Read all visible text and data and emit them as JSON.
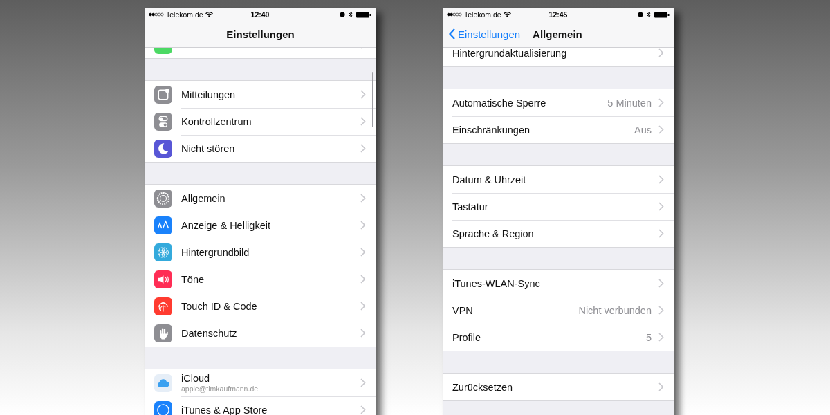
{
  "phones": [
    {
      "status": {
        "carrier": "Telekom.de",
        "time": "12:40"
      },
      "nav": {
        "title": "Einstellungen"
      },
      "groups": [
        {
          "rows": [
            {
              "kind": "green"
            }
          ]
        },
        {
          "rows": [
            {
              "kind": "notifications",
              "label": "Mitteilungen"
            },
            {
              "kind": "switches",
              "label": "Kontrollzentrum"
            },
            {
              "kind": "moon",
              "label": "Nicht stören"
            }
          ]
        },
        {
          "rows": [
            {
              "kind": "gear",
              "label": "Allgemein"
            },
            {
              "kind": "letters",
              "label": "Anzeige & Helligkeit"
            },
            {
              "kind": "flower",
              "label": "Hintergrundbild"
            },
            {
              "kind": "speaker",
              "label": "Töne"
            },
            {
              "kind": "fingerprint",
              "label": "Touch ID & Code"
            },
            {
              "kind": "hand",
              "label": "Datenschutz"
            }
          ]
        },
        {
          "rows": [
            {
              "kind": "cloud",
              "label": "iCloud",
              "subtitle": "apple@timkaufmann.de"
            },
            {
              "kind": "blue-circle",
              "label": "iTunes & App Store"
            }
          ]
        }
      ]
    },
    {
      "status": {
        "carrier": "Telekom.de",
        "time": "12:45"
      },
      "nav": {
        "title": "Allgemein",
        "back": "Einstellungen"
      },
      "groups": [
        {
          "rows": [
            {
              "label": "Hintergrundaktualisierung"
            }
          ]
        },
        {
          "rows": [
            {
              "label": "Automatische Sperre",
              "value": "5 Minuten"
            },
            {
              "label": "Einschränkungen",
              "value": "Aus"
            }
          ]
        },
        {
          "rows": [
            {
              "label": "Datum & Uhrzeit"
            },
            {
              "label": "Tastatur"
            },
            {
              "label": "Sprache & Region"
            }
          ]
        },
        {
          "rows": [
            {
              "label": "iTunes-WLAN-Sync"
            },
            {
              "label": "VPN",
              "value": "Nicht verbunden"
            },
            {
              "label": "Profile",
              "value": "5"
            }
          ]
        },
        {
          "rows": [
            {
              "label": "Zurücksetzen"
            }
          ]
        }
      ]
    }
  ]
}
